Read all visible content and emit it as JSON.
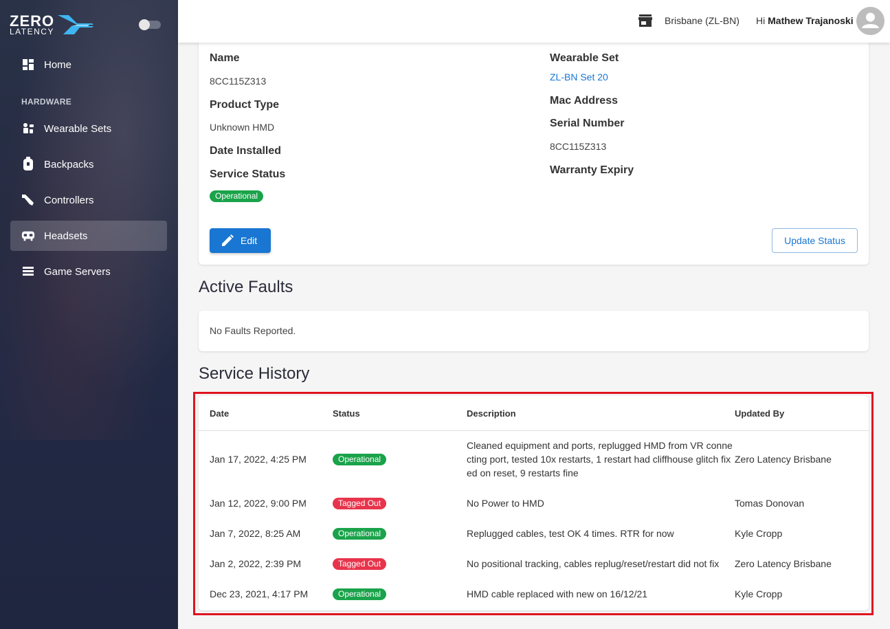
{
  "brand": {
    "line1": "ZERO",
    "line2": "LATENCY"
  },
  "sidebar": {
    "section_label": "HARDWARE",
    "items": [
      {
        "label": "Home",
        "icon": "dashboard-icon"
      },
      {
        "label": "Wearable Sets",
        "icon": "wearable-icon"
      },
      {
        "label": "Backpacks",
        "icon": "backpack-icon"
      },
      {
        "label": "Controllers",
        "icon": "controller-icon"
      },
      {
        "label": "Headsets",
        "icon": "headset-icon",
        "active": true
      },
      {
        "label": "Game Servers",
        "icon": "server-icon"
      }
    ]
  },
  "header": {
    "location": "Brisbane (ZL-BN)",
    "greeting_prefix": "Hi",
    "user_name": "Mathew Trajanoski"
  },
  "detail": {
    "name_label": "Name",
    "name_value": "8CC115Z313",
    "product_type_label": "Product Type",
    "product_type_value": "Unknown HMD",
    "date_installed_label": "Date Installed",
    "service_status_label": "Service Status",
    "service_status_value": "Operational",
    "wearable_set_label": "Wearable Set",
    "wearable_set_value": "ZL-BN Set 20",
    "mac_address_label": "Mac Address",
    "serial_number_label": "Serial Number",
    "serial_number_value": "8CC115Z313",
    "warranty_expiry_label": "Warranty Expiry",
    "edit_label": "Edit",
    "update_status_label": "Update Status"
  },
  "faults": {
    "title": "Active Faults",
    "empty_text": "No Faults Reported."
  },
  "history": {
    "title": "Service History",
    "columns": [
      "Date",
      "Status",
      "Description",
      "Updated By"
    ],
    "rows": [
      {
        "date": "Jan 17, 2022, 4:25 PM",
        "status": "Operational",
        "description": "Cleaned equipment and ports, replugged HMD from VR connecting port, tested 10x restarts, 1 restart had cliffhouse glitch fixed on reset, 9 restarts fine",
        "updated_by": "Zero Latency Brisbane"
      },
      {
        "date": "Jan 12, 2022, 9:00 PM",
        "status": "Tagged Out",
        "description": "No Power to HMD",
        "updated_by": "Tomas Donovan"
      },
      {
        "date": "Jan 7, 2022, 8:25 AM",
        "status": "Operational",
        "description": "Replugged cables, test OK 4 times. RTR for now",
        "updated_by": "Kyle Cropp"
      },
      {
        "date": "Jan 2, 2022, 2:39 PM",
        "status": "Tagged Out",
        "description": "No positional tracking, cables replug/reset/restart did not fix",
        "updated_by": "Zero Latency Brisbane"
      },
      {
        "date": "Dec 23, 2021, 4:17 PM",
        "status": "Operational",
        "description": "HMD cable replaced with new on 16/12/21",
        "updated_by": "Kyle Cropp"
      }
    ]
  },
  "colors": {
    "operational": "#1aa34a",
    "tagged_out": "#e8344b",
    "primary": "#1976d2",
    "sidebar": "#242b42"
  }
}
